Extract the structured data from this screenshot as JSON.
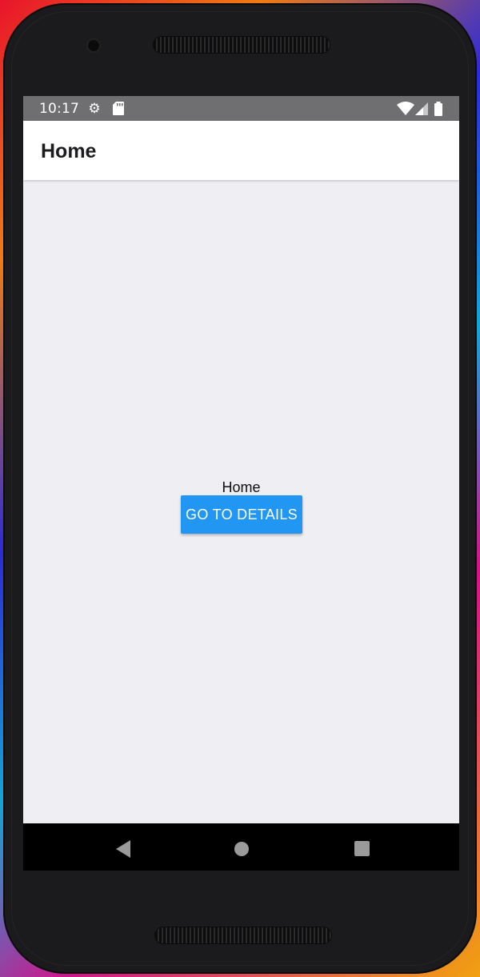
{
  "status_bar": {
    "time": "10:17",
    "icons": [
      "gear-icon",
      "sd-card-icon",
      "wifi-icon",
      "cell-signal-icon",
      "battery-icon"
    ]
  },
  "app_bar": {
    "title": "Home"
  },
  "main": {
    "label": "Home",
    "button_label": "GO TO DETAILS",
    "button_color": "#2196f3",
    "background_color": "#efeff3"
  },
  "nav_bar": {
    "icons": [
      "back-icon",
      "home-icon",
      "recents-icon"
    ]
  }
}
